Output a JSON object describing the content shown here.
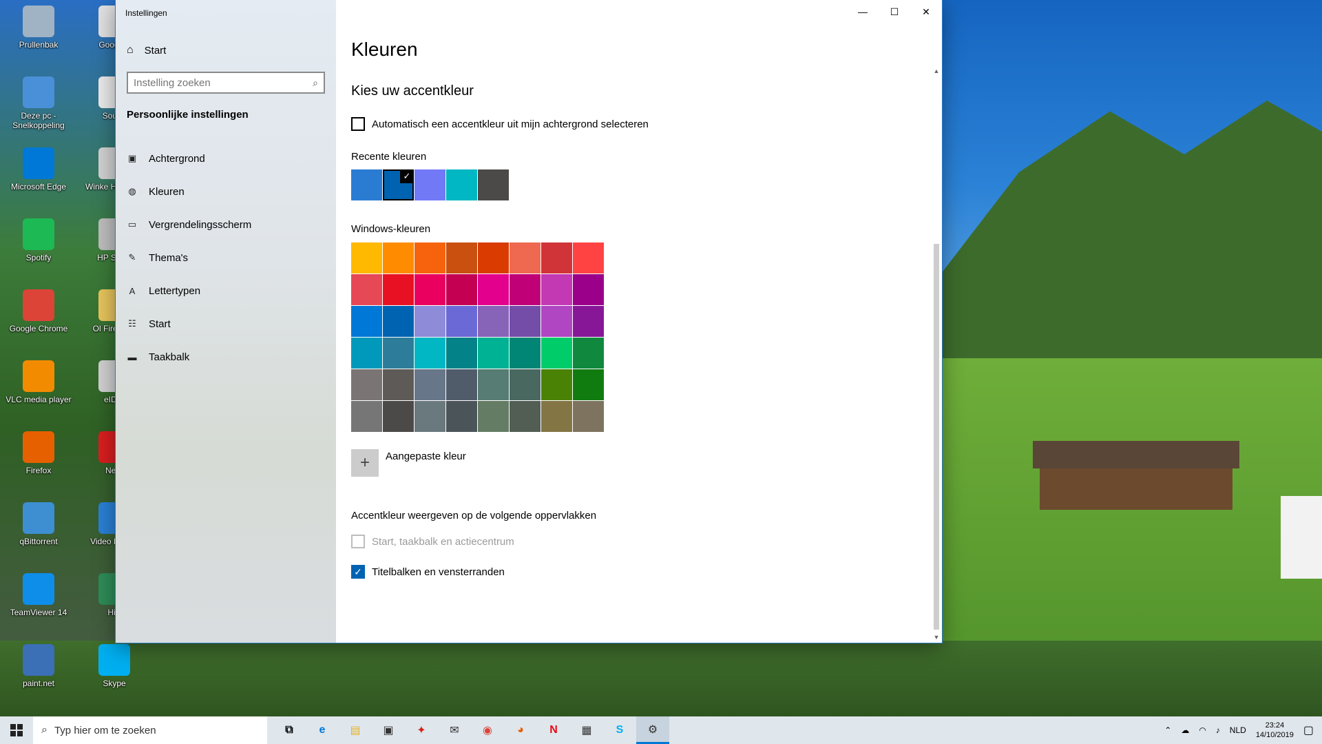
{
  "desktop": {
    "icons_col1": [
      {
        "label": "Prullenbak",
        "icon": "recycle-bin-icon",
        "color": "#9fb3c4"
      },
      {
        "label": "Deze pc - Snelkoppeling",
        "icon": "pc-icon",
        "color": "#4a90d9"
      },
      {
        "label": "Microsoft Edge",
        "icon": "edge-icon",
        "color": "#0078d7"
      },
      {
        "label": "Spotify",
        "icon": "spotify-icon",
        "color": "#1db954"
      },
      {
        "label": "Google Chrome",
        "icon": "chrome-icon",
        "color": "#db4437"
      },
      {
        "label": "VLC media player",
        "icon": "vlc-icon",
        "color": "#f28b00"
      },
      {
        "label": "Firefox",
        "icon": "firefox-icon",
        "color": "#e66000"
      },
      {
        "label": "qBittorrent",
        "icon": "qbittorrent-icon",
        "color": "#3d8fd1"
      },
      {
        "label": "TeamViewer 14",
        "icon": "teamviewer-icon",
        "color": "#0e8ee9"
      },
      {
        "label": "paint.net",
        "icon": "paintnet-icon",
        "color": "#3b6fb6"
      }
    ],
    "icons_col2": [
      {
        "label": "Google I",
        "icon": "google-icon",
        "color": "#e0e0e0"
      },
      {
        "label": "Sound",
        "icon": "sound-icon",
        "color": "#e8e8e8"
      },
      {
        "label": "Winke HP-beno",
        "icon": "hp-icon",
        "color": "#d0d0d0"
      },
      {
        "label": "HP Soluti",
        "icon": "hp-solutions-icon",
        "color": "#bdbdbd"
      },
      {
        "label": "Ol Firefox-g",
        "icon": "folder-icon",
        "color": "#e6c35c"
      },
      {
        "label": "eID V",
        "icon": "eid-icon",
        "color": "#cfcfcf"
      },
      {
        "label": "Nero",
        "icon": "nero-icon",
        "color": "#d81e1e"
      },
      {
        "label": "Video Do Ulti",
        "icon": "video-download-icon",
        "color": "#2a7fd4"
      },
      {
        "label": "HiS",
        "icon": "his-icon",
        "color": "#2e8b57"
      },
      {
        "label": "Skype",
        "icon": "skype-icon",
        "color": "#00aff0"
      }
    ]
  },
  "window": {
    "title": "Instellingen",
    "min_glyph": "—",
    "max_glyph": "☐",
    "close_glyph": "✕"
  },
  "sidebar": {
    "home_label": "Start",
    "search_placeholder": "Instelling zoeken",
    "section_title": "Persoonlijke instellingen",
    "items": [
      {
        "label": "Achtergrond",
        "icon": "picture-icon",
        "glyph": "▣"
      },
      {
        "label": "Kleuren",
        "icon": "palette-icon",
        "glyph": "◍"
      },
      {
        "label": "Vergrendelingsscherm",
        "icon": "lockscreen-icon",
        "glyph": "▭"
      },
      {
        "label": "Thema's",
        "icon": "brush-icon",
        "glyph": "✎"
      },
      {
        "label": "Lettertypen",
        "icon": "font-icon",
        "glyph": "A"
      },
      {
        "label": "Start",
        "icon": "start-menu-icon",
        "glyph": "☷"
      },
      {
        "label": "Taakbalk",
        "icon": "taskbar-icon",
        "glyph": "▬"
      }
    ]
  },
  "content": {
    "page_title": "Kleuren",
    "subheader": "Kies uw accentkleur",
    "auto_accent_label": "Automatisch een accentkleur uit mijn achtergrond selecteren",
    "recent_label": "Recente kleuren",
    "recent_colors": [
      "#2a7cd3",
      "#0063b1",
      "#7279f7",
      "#00b7c3",
      "#4c4a48"
    ],
    "recent_selected_index": 1,
    "windows_colors_label": "Windows-kleuren",
    "palette": [
      "#ffb900",
      "#ff8c00",
      "#f7630c",
      "#ca5010",
      "#da3b01",
      "#ef6950",
      "#d13438",
      "#ff4343",
      "#e74856",
      "#e81123",
      "#ea005e",
      "#c30052",
      "#e3008c",
      "#bf0077",
      "#c239b3",
      "#9a0089",
      "#0078d7",
      "#0063b1",
      "#8e8cd8",
      "#6b69d6",
      "#8764b8",
      "#744da9",
      "#b146c2",
      "#881798",
      "#0099bc",
      "#2d7d9a",
      "#00b7c3",
      "#038387",
      "#00b294",
      "#018574",
      "#00cc6a",
      "#10893e",
      "#7a7574",
      "#5d5a58",
      "#68768a",
      "#515c6b",
      "#567c73",
      "#486860",
      "#498205",
      "#107c10",
      "#767676",
      "#4c4a48",
      "#69797e",
      "#4a5459",
      "#647c64",
      "#525e54",
      "#847545",
      "#7e735f"
    ],
    "custom_color_label": "Aangepaste kleur",
    "surfaces_label": "Accentkleur weergeven op de volgende oppervlakken",
    "surface_start_label": "Start, taakbalk en actiecentrum",
    "surface_titlebar_label": "Titelbalken en vensterranden"
  },
  "taskbar": {
    "search_placeholder": "Typ hier om te zoeken",
    "apps": [
      {
        "icon": "task-view-icon",
        "glyph": "⧉",
        "color": "#000000"
      },
      {
        "icon": "edge-icon",
        "glyph": "e",
        "color": "#0078d7"
      },
      {
        "icon": "file-explorer-icon",
        "glyph": "▤",
        "color": "#e6b324"
      },
      {
        "icon": "store-icon",
        "glyph": "▣",
        "color": "#333333"
      },
      {
        "icon": "acrobat-icon",
        "glyph": "✦",
        "color": "#d4251b"
      },
      {
        "icon": "mail-icon",
        "glyph": "✉",
        "color": "#333333"
      },
      {
        "icon": "chrome-icon",
        "glyph": "◉",
        "color": "#db4437"
      },
      {
        "icon": "firefox-icon",
        "glyph": "◕",
        "color": "#e66000"
      },
      {
        "icon": "netflix-icon",
        "glyph": "N",
        "color": "#e50914"
      },
      {
        "icon": "calculator-icon",
        "glyph": "▦",
        "color": "#333333"
      },
      {
        "icon": "skype-icon",
        "glyph": "S",
        "color": "#00aff0"
      },
      {
        "icon": "settings-icon",
        "glyph": "⚙",
        "color": "#333333"
      }
    ],
    "language": "NLD",
    "time": "23:24",
    "date": "14/10/2019"
  }
}
